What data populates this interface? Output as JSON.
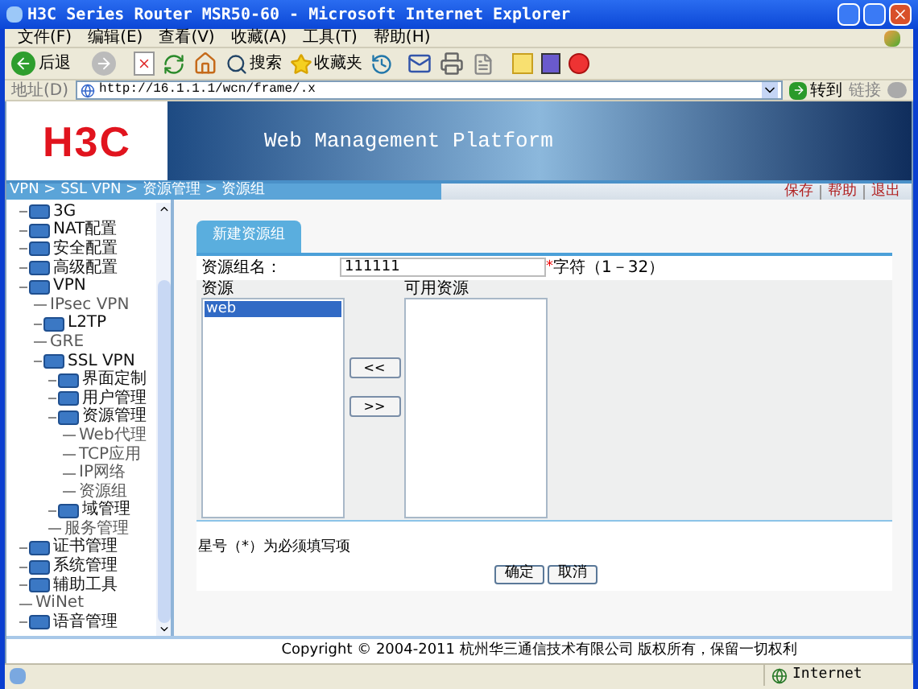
{
  "window": {
    "title": "H3C Series Router MSR50-60 - Microsoft Internet Explorer"
  },
  "menu": [
    "文件(F)",
    "编辑(E)",
    "查看(V)",
    "收藏(A)",
    "工具(T)",
    "帮助(H)"
  ],
  "toolbar": {
    "back": "后退",
    "search": "搜索",
    "favorites": "收藏夹"
  },
  "address_bar": {
    "label": "地址(D)",
    "url": "http://16.1.1.1/wcn/frame/.x",
    "go": "转到",
    "links": "链接"
  },
  "header": {
    "logo": "H3C",
    "title": "Web Management Platform"
  },
  "breadcrumb": "VPN > SSL VPN > 资源管理 > 资源组",
  "top_links": [
    "保存",
    "帮助",
    "退出"
  ],
  "tree": [
    {
      "label": "3G",
      "kind": "folder"
    },
    {
      "label": "NAT配置",
      "kind": "folder"
    },
    {
      "label": "安全配置",
      "kind": "folder"
    },
    {
      "label": "高级配置",
      "kind": "folder"
    },
    {
      "label": "VPN",
      "kind": "folder",
      "children": [
        {
          "label": "IPsec VPN",
          "kind": "leaf"
        },
        {
          "label": "L2TP",
          "kind": "folder"
        },
        {
          "label": "GRE",
          "kind": "leaf"
        },
        {
          "label": "SSL VPN",
          "kind": "folder",
          "children": [
            {
              "label": "界面定制",
              "kind": "folder"
            },
            {
              "label": "用户管理",
              "kind": "folder"
            },
            {
              "label": "资源管理",
              "kind": "folder",
              "children": [
                {
                  "label": "Web代理",
                  "kind": "leaf"
                },
                {
                  "label": "TCP应用",
                  "kind": "leaf"
                },
                {
                  "label": "IP网络",
                  "kind": "leaf"
                },
                {
                  "label": "资源组",
                  "kind": "leaf"
                }
              ]
            },
            {
              "label": "域管理",
              "kind": "folder"
            },
            {
              "label": "服务管理",
              "kind": "leaf"
            }
          ]
        }
      ]
    },
    {
      "label": "证书管理",
      "kind": "folder"
    },
    {
      "label": "系统管理",
      "kind": "folder"
    },
    {
      "label": "辅助工具",
      "kind": "folder"
    },
    {
      "label": "WiNet",
      "kind": "leaf"
    },
    {
      "label": "语音管理",
      "kind": "folder"
    }
  ],
  "form": {
    "tab": {
      "label": "新建资源组",
      "selected": true
    },
    "name_label": "资源组名：",
    "name_value": "111111",
    "required_mark": "*",
    "hint": "字符（1－32）",
    "resources_label": "资源",
    "resources": [
      {
        "label": "web",
        "selected": true
      }
    ],
    "available_label": "可用资源",
    "add_button": "<<",
    "remove_button": ">>",
    "note": "星号（*）为必须填写项",
    "buttons": [
      "确定",
      "取消"
    ]
  },
  "footer": "Copyright © 2004-2011 杭州华三通信技术有限公司 版权所有，保留一切权利",
  "status_bar": {
    "zone": "Internet"
  }
}
